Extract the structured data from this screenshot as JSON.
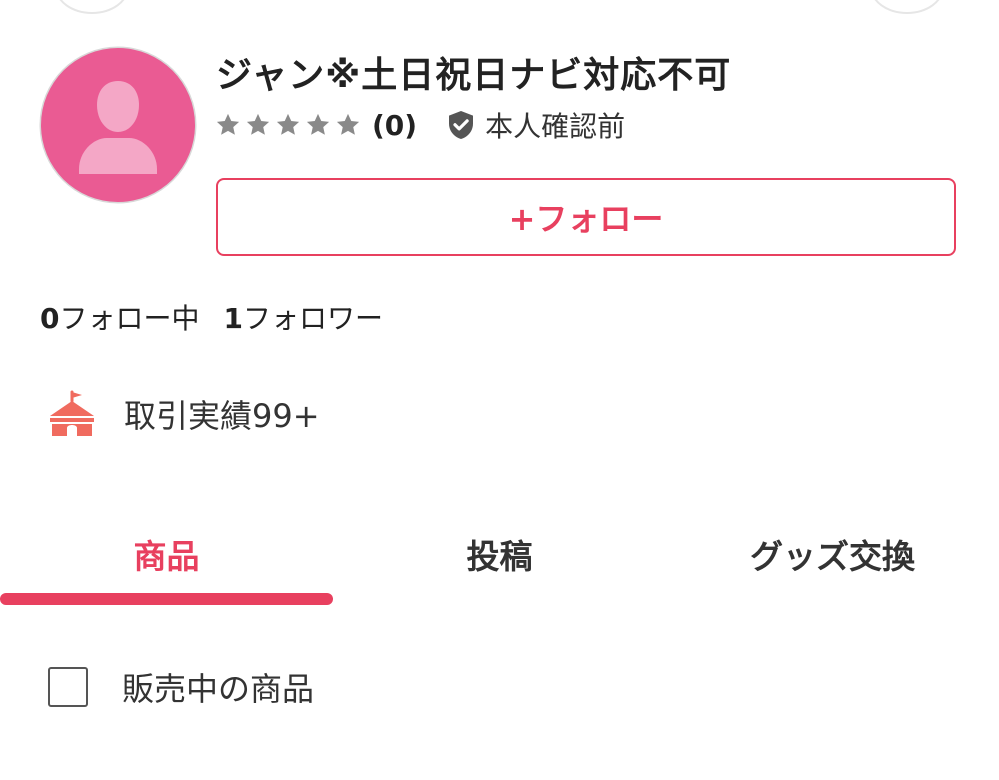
{
  "profile": {
    "username": "ジャン※土日祝日ナビ対応不可",
    "rating_stars": 5,
    "rating_count": "(0)",
    "verification_label": "本人確認前",
    "follow_button_label": "+フォロー",
    "following_count": "0",
    "following_label": "フォロー中",
    "followers_count": "1",
    "followers_label": "フォロワー",
    "trade_record_label": "取引実績99+"
  },
  "tabs": [
    {
      "label": "商品",
      "active": true
    },
    {
      "label": "投稿",
      "active": false
    },
    {
      "label": "グッズ交換",
      "active": false
    }
  ],
  "filter": {
    "checkbox_label": "販売中の商品",
    "checked": false
  },
  "icons": {
    "avatar": "default-user-avatar-icon",
    "star": "star-icon",
    "verification": "shield-check-icon",
    "trade": "tent-icon"
  },
  "colors": {
    "accent": "#e8405f",
    "avatar_bg": "#ea5b93",
    "avatar_figure": "#f4a7c6",
    "star": "#8a8a8a",
    "shield": "#555555",
    "tent": "#f06b5f",
    "text": "#222222"
  }
}
